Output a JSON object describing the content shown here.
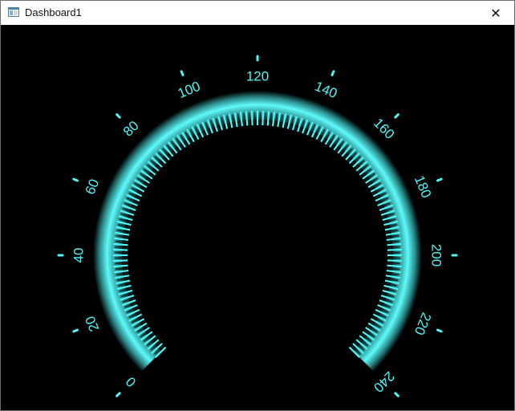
{
  "window": {
    "title": "Dashboard1",
    "app_icon": "window-app-icon",
    "close_icon": "close-icon",
    "close_glyph": "✕"
  },
  "gauge": {
    "value": 0,
    "min": 0,
    "max": 240,
    "labels": [
      "0",
      "20",
      "40",
      "60",
      "80",
      "100",
      "120",
      "140",
      "160",
      "180",
      "200",
      "220",
      "240"
    ],
    "minor_divisions": 120,
    "accent_color": "#4ff7f7",
    "background_color": "#000000"
  }
}
